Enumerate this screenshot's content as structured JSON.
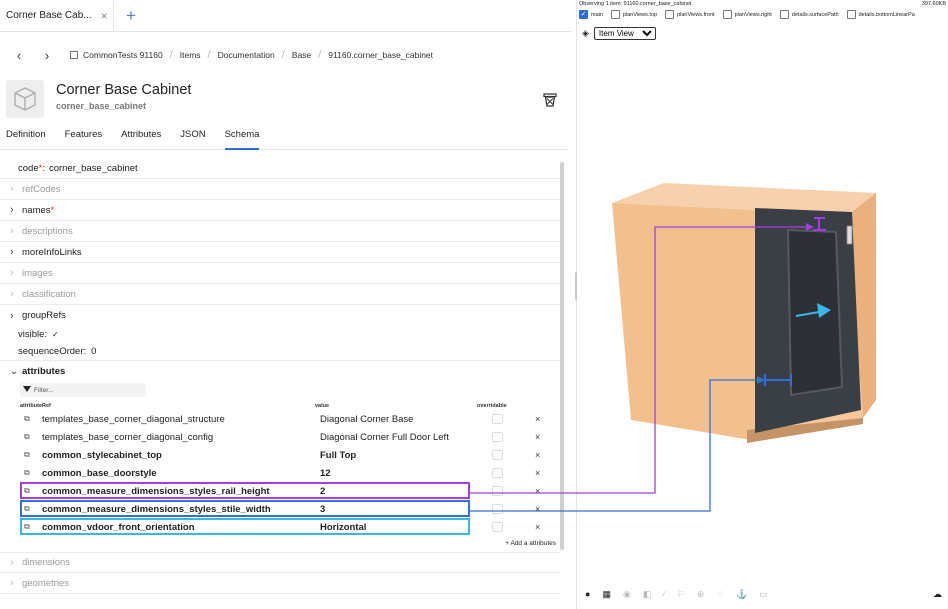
{
  "tabs_bar": {
    "active_tab": "Corner Base Cab...",
    "close": "×",
    "new": "+"
  },
  "nav": {
    "back": "‹",
    "forward": "›",
    "breadcrumb": [
      "CommonTests 91160",
      "Items",
      "Documentation",
      "Base",
      "91160.corner_base_cabinet"
    ],
    "sep": "/"
  },
  "item": {
    "title": "Corner Base Cabinet",
    "subtitle": "corner_base_cabinet"
  },
  "detail_tabs": [
    "Definition",
    "Features",
    "Attributes",
    "JSON",
    "Schema"
  ],
  "active_detail_tab": "Schema",
  "schema": {
    "code_label": "code",
    "required_mark": "*",
    "colon": ":",
    "code_value": "corner_base_cabinet",
    "sections": [
      {
        "label": "refCodes",
        "enabled": false,
        "required": false
      },
      {
        "label": "names",
        "enabled": true,
        "required": true
      },
      {
        "label": "descriptions",
        "enabled": false,
        "required": false
      },
      {
        "label": "moreInfoLinks",
        "enabled": true,
        "required": false
      },
      {
        "label": "images",
        "enabled": false,
        "required": false
      },
      {
        "label": "classification",
        "enabled": false,
        "required": false
      },
      {
        "label": "groupRefs",
        "enabled": true,
        "required": false
      }
    ],
    "visible_label": "visible:",
    "visible_value": "✓",
    "sequence_label": "sequenceOrder:",
    "sequence_value": "0",
    "attributes_label": "attributes",
    "filter_placeholder": "Filter...",
    "col_attribute": "attributeRef",
    "col_value": "value",
    "col_overridable": "overridable",
    "attributes": [
      {
        "name": "templates_base_corner_diagonal_structure",
        "value": "Diagonal Corner Base",
        "bold": false
      },
      {
        "name": "templates_base_corner_diagonal_config",
        "value": "Diagonal Corner Full Door Left",
        "bold": false
      },
      {
        "name": "common_stylecabinet_top",
        "value": "Full Top",
        "bold": true
      },
      {
        "name": "common_base_doorstyle",
        "value": "12",
        "bold": true
      },
      {
        "name": "common_measure_dimensions_styles_rail_height",
        "value": "2",
        "bold": true
      },
      {
        "name": "common_measure_dimensions_styles_stile_width",
        "value": "3",
        "bold": true
      },
      {
        "name": "common_vdoor_front_orientation",
        "value": "Horizontal",
        "bold": true
      }
    ],
    "delete_glyph": "×",
    "add_attribute": "+ Add a attributes",
    "after_sections": [
      {
        "label": "dimensions",
        "enabled": false
      },
      {
        "label": "geometries",
        "enabled": false
      }
    ]
  },
  "viewer": {
    "observing": "Observing 1 item: 91160.corner_base_cabinet",
    "size": "397.60KB",
    "checkboxes": [
      {
        "label": "main",
        "checked": true
      },
      {
        "label": "planViews.top",
        "checked": false
      },
      {
        "label": "planViews.front",
        "checked": false
      },
      {
        "label": "planViews.right",
        "checked": false
      },
      {
        "label": "details.surfacePath",
        "checked": false
      },
      {
        "label": "details.bottomLinearPa",
        "checked": false
      }
    ],
    "view_select": "Item View",
    "bottom_icons": [
      "palette-icon",
      "grid-icon",
      "compass-icon",
      "cube-icon",
      "brush-icon",
      "flag-icon",
      "target-icon",
      "dots-icon",
      "anchor-icon",
      "image-icon",
      "cloud-icon"
    ]
  },
  "colors": {
    "purple": "#a23de8",
    "blue": "#2f6fe0",
    "cyan": "#36b8ea",
    "cabinet_body": "#f2c294",
    "cabinet_top": "#f7d1ad",
    "door": "#3a3f45",
    "accent": "#2a6fd9"
  }
}
